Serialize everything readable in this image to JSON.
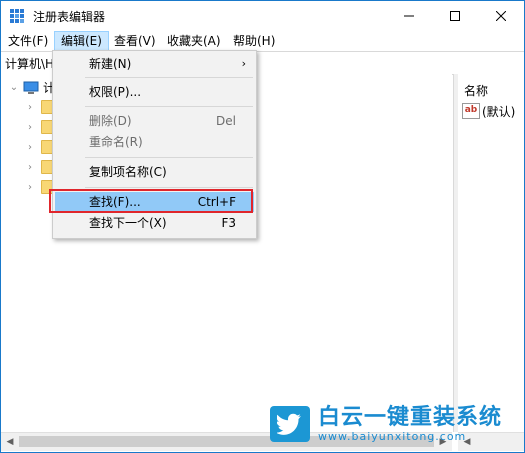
{
  "window": {
    "title": "注册表编辑器"
  },
  "menubar": {
    "items": [
      "文件(F)",
      "编辑(E)",
      "查看(V)",
      "收藏夹(A)",
      "帮助(H)"
    ]
  },
  "address": {
    "text": "计算机\\H"
  },
  "tree": {
    "root_label": "计"
  },
  "list": {
    "col_name": "名称",
    "default_value": "(默认)"
  },
  "edit_menu": {
    "new": "新建(N)",
    "permissions": "权限(P)...",
    "delete": "删除(D)",
    "delete_shortcut": "Del",
    "rename": "重命名(R)",
    "copy_key_name": "复制项名称(C)",
    "find": "查找(F)...",
    "find_shortcut": "Ctrl+F",
    "find_next": "查找下一个(X)",
    "find_next_shortcut": "F3"
  },
  "watermark": {
    "title": "白云一键重装系统",
    "url": "www.baiyunxitong.com"
  },
  "colors": {
    "accent": "#1979ca",
    "highlight": "#91c9f7",
    "annotation": "#e0262c",
    "folder": "#f8d775"
  }
}
